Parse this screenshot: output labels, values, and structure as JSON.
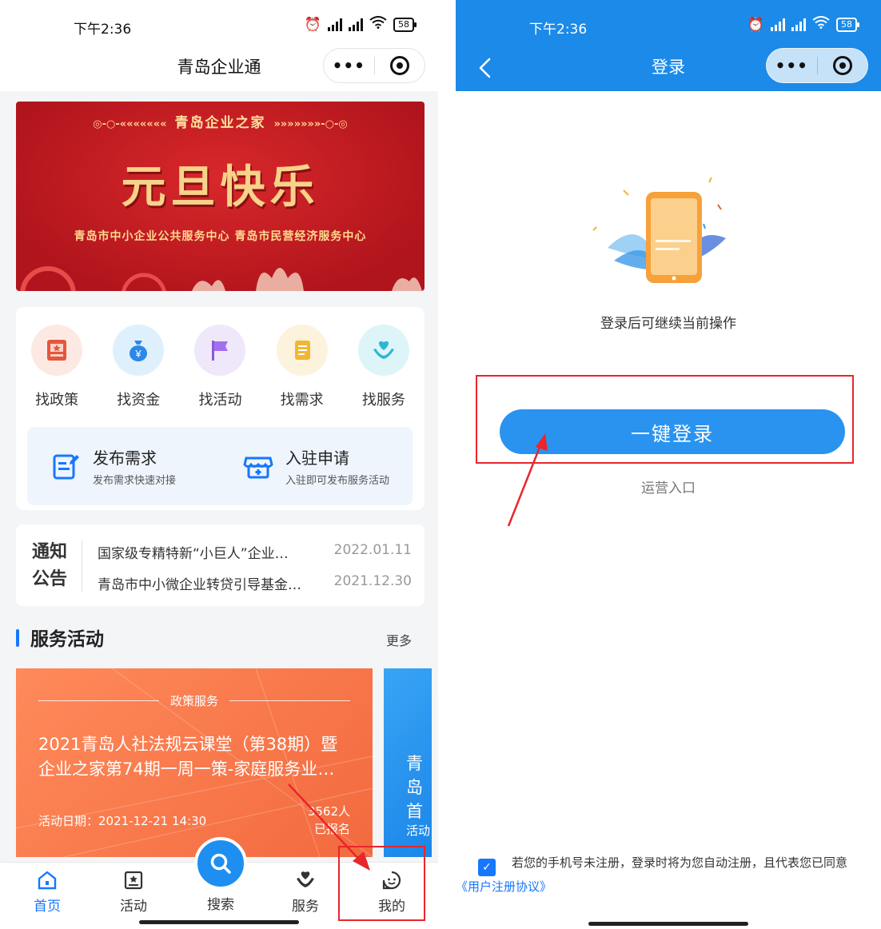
{
  "left": {
    "status": {
      "time": "下午2:36",
      "battery": "58"
    },
    "nav": {
      "title": "青岛企业通",
      "more": "•••"
    },
    "banner": {
      "top": "青岛企业之家",
      "title": "元旦快乐",
      "subtitle": "青岛市中小企业公共服务中心  青岛市民营经济服务中心"
    },
    "grid": [
      {
        "label": "找政策"
      },
      {
        "label": "找资金"
      },
      {
        "label": "找活动"
      },
      {
        "label": "找需求"
      },
      {
        "label": "找服务"
      }
    ],
    "quick": [
      {
        "title": "发布需求",
        "sub": "发布需求快速对接"
      },
      {
        "title": "入驻申请",
        "sub": "入驻即可发布服务活动"
      }
    ],
    "notice": {
      "tag": "通知公告",
      "items": [
        {
          "title": "国家级专精特新“小巨人”企业…",
          "date": "2022.01.11"
        },
        {
          "title": "青岛市中小微企业转贷引导基金…",
          "date": "2021.12.30"
        }
      ]
    },
    "section": {
      "title": "服务活动",
      "more": "更多"
    },
    "activity": {
      "category": "政策服务",
      "title": "2021青岛人社法规云课堂（第38期）暨企业之家第74期一周一策-家庭服务业政策…",
      "date": "活动日期：2021-12-21 14:30",
      "count": "3562人",
      "count_label": "已报名"
    },
    "activity2": {
      "title": "青岛首",
      "date": "活动"
    },
    "tabbar": {
      "home": "首页",
      "activity": "活动",
      "search": "搜索",
      "service": "服务",
      "mine": "我的"
    }
  },
  "right": {
    "status": {
      "time": "下午2:36",
      "battery": "58"
    },
    "nav": {
      "title": "登录",
      "more": "•••"
    },
    "hint": "登录后可继续当前操作",
    "login_button": "一键登录",
    "ops_link": "运营入口",
    "agreement": "若您的手机号未注册，登录时将为您自动注册，且代表您已同意",
    "agreement_link": "《用户注册协议》"
  },
  "colors": {
    "primary": "#1677ff",
    "nav_blue": "#1c8ae8",
    "highlight": "#e8262b",
    "banner_red": "#c21a22",
    "activity_orange": "#f26a3f"
  }
}
